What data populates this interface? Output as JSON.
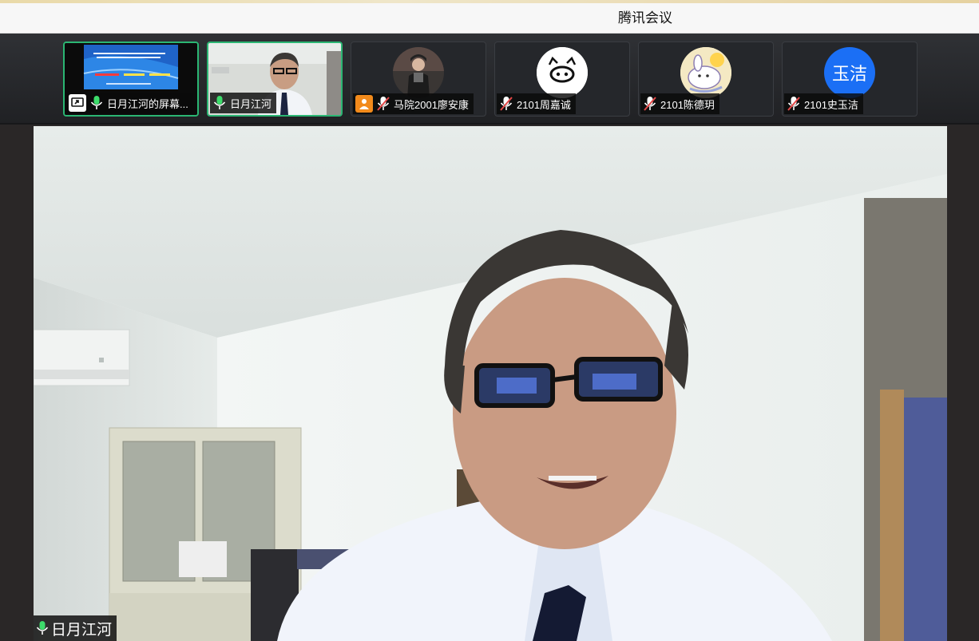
{
  "window": {
    "title": "腾讯会议"
  },
  "participants": [
    {
      "name": "日月江河的屏幕...",
      "mic": "on",
      "type": "screen-share",
      "active": true
    },
    {
      "name": "日月江河",
      "mic": "on",
      "type": "video",
      "active": true
    },
    {
      "name": "马院2001廖安康",
      "mic": "muted",
      "type": "avatar-photo",
      "active": false
    },
    {
      "name": "2101周嘉诚",
      "mic": "muted",
      "type": "avatar-pig",
      "active": false
    },
    {
      "name": "2101陈德玥",
      "mic": "muted",
      "type": "avatar-cartoon",
      "active": false
    },
    {
      "name": "2101史玉洁",
      "mic": "muted",
      "type": "avatar-text",
      "avatar_text": "玉洁",
      "active": false
    }
  ],
  "main_video": {
    "speaker_name": "日月江河",
    "mic": "on"
  },
  "colors": {
    "active_border": "#2bb673",
    "mic_on": "#3ddc6b",
    "mic_muted": "#e54848",
    "avatar_blue": "#1b6ff5",
    "person_badge": "#f28a1b"
  }
}
